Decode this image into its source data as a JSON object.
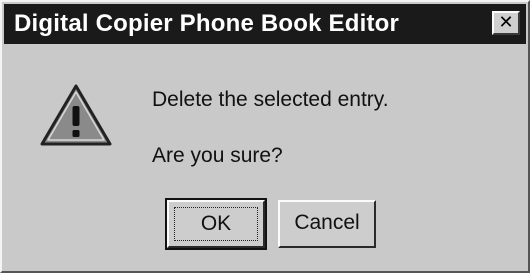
{
  "dialog": {
    "title": "Digital Copier Phone Book Editor",
    "close_label": "✕",
    "icon": "warning-icon",
    "message_line1": "Delete the selected entry.",
    "message_line2": "Are you sure?",
    "buttons": {
      "ok_label": "OK",
      "cancel_label": "Cancel"
    },
    "colors": {
      "titlebar": "#1a1a1a",
      "title_text": "#ffffff",
      "face": "#c9c9c9"
    }
  }
}
